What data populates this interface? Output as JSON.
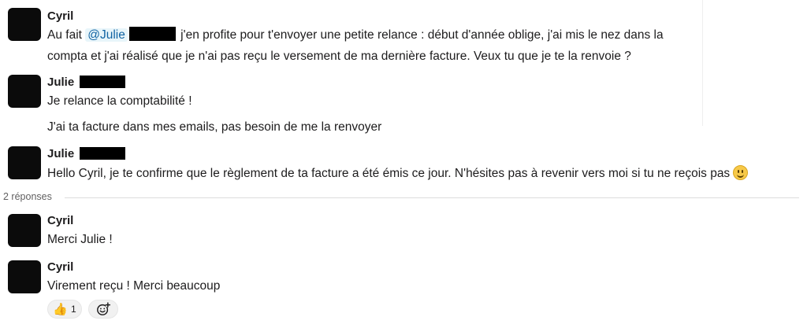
{
  "messages": [
    {
      "author": "Cyril",
      "lines": [
        {
          "pre": "Au fait ",
          "mention": "@Julie",
          "post": " j'en profite pour t'envoyer une petite relance : début d'année oblige, j'ai mis le nez dans la"
        },
        {
          "text": "compta et j'ai réalisé que je n'ai pas reçu le versement de ma dernière facture. Veux tu que je te la renvoie ?"
        }
      ]
    },
    {
      "author": "Julie",
      "lines": [
        {
          "text": "Je relance la comptabilité !"
        },
        {
          "text": "J'ai ta facture dans mes emails, pas besoin de me la renvoyer"
        }
      ]
    },
    {
      "author": "Julie",
      "lines": [
        {
          "text": "Hello Cyril, je te confirme que le règlement de ta facture a été émis ce jour. N'hésites pas à revenir vers moi si tu ne reçois pas",
          "emoji": "slightly-smiling-face"
        }
      ]
    }
  ],
  "thread": {
    "reply_count_label": "2 réponses",
    "replies": [
      {
        "author": "Cyril",
        "text": "Merci Julie !"
      },
      {
        "author": "Cyril",
        "text": "Virement reçu ! Merci beaucoup"
      }
    ]
  },
  "reactions": [
    {
      "emoji": "👍",
      "icon": "thumbs-up-icon",
      "count": "1"
    },
    {
      "icon": "add-reaction-icon"
    }
  ]
}
